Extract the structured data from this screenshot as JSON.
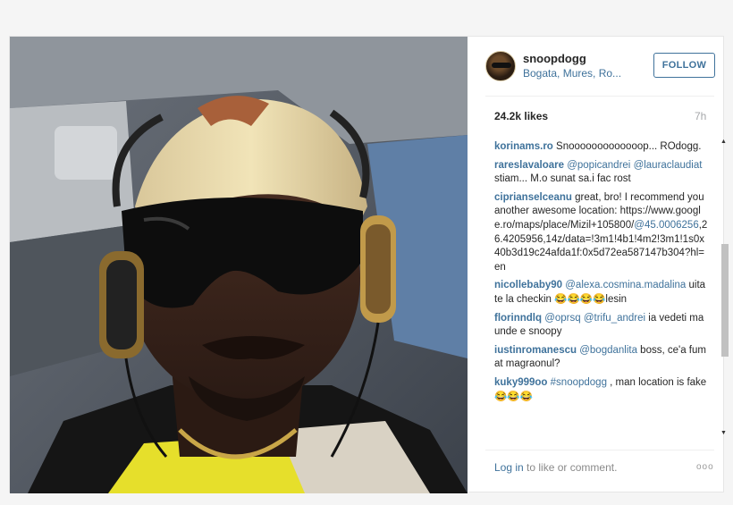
{
  "post": {
    "username": "snoopdogg",
    "location": "Bogata, Mures, Ro...",
    "follow_label": "FOLLOW",
    "likes": "24.2k likes",
    "time": "7h"
  },
  "comments": [
    {
      "user": "korinams.ro",
      "parts": [
        {
          "t": " Snooooooooooooop... ROdogg.",
          "link": false
        }
      ]
    },
    {
      "user": "rareslavaloare",
      "parts": [
        {
          "t": " @popicandrei",
          "link": true
        },
        {
          "t": " ",
          "link": false
        },
        {
          "t": "@lauraclaudiat",
          "link": true
        },
        {
          "t": " stiam... M.o sunat sa.i fac rost",
          "link": false
        }
      ]
    },
    {
      "user": "ciprianselceanu",
      "parts": [
        {
          "t": " great, bro! I recommend you another awesome location: https://www.google.ro/maps/place/Mizil+105800/",
          "link": false
        },
        {
          "t": "@45.0006256",
          "link": true
        },
        {
          "t": ",26.4205956,14z/data=!3m1!4b1!4m2!3m1!1s0x40b3d19c24afda1f:0x5d72ea587147b304?hl=en",
          "link": false
        }
      ]
    },
    {
      "user": "nicollebaby90",
      "parts": [
        {
          "t": " @alexa.cosmina.madalina",
          "link": true
        },
        {
          "t": " uita te la checkin 😂😂😂😂lesin",
          "link": false
        }
      ]
    },
    {
      "user": "florinndlq",
      "parts": [
        {
          "t": " @oprsq",
          "link": true
        },
        {
          "t": " ",
          "link": false
        },
        {
          "t": "@trifu_andrei",
          "link": true
        },
        {
          "t": " ia vedeti ma unde e snoopy",
          "link": false
        }
      ]
    },
    {
      "user": "iustinromanescu",
      "parts": [
        {
          "t": " @bogdanlita",
          "link": true
        },
        {
          "t": " boss, ce'a fumat magraonul?",
          "link": false
        }
      ]
    },
    {
      "user": "kuky999oo",
      "parts": [
        {
          "t": " #snoopdogg",
          "link": true
        },
        {
          "t": " , man location is fake 😂😂😂",
          "link": false
        }
      ]
    }
  ],
  "footer": {
    "login_link": "Log in",
    "login_rest": " to like or comment.",
    "more": "ooo"
  },
  "icons": {
    "scroll_up": "scroll-up-arrow-icon",
    "scroll_down": "scroll-down-arrow-icon",
    "more": "more-options-icon"
  },
  "colors": {
    "link": "#3f729b",
    "muted": "#a5a7aa",
    "border": "#e6e6e6"
  }
}
